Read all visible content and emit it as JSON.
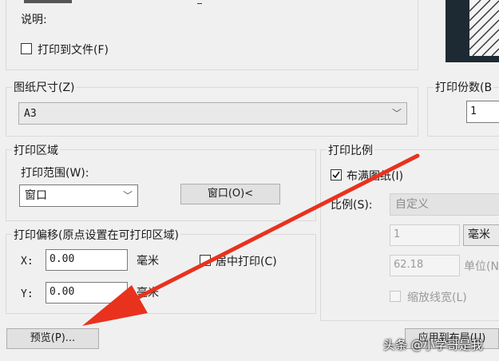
{
  "printer": {
    "description_label": "说明:",
    "print_to_file_label": "打印到文件(F)"
  },
  "paper_size": {
    "group_label": "图纸尺寸(Z)",
    "selected": "A3"
  },
  "copies": {
    "group_label": "打印份数(B",
    "value": "1"
  },
  "plot_area": {
    "group_label": "打印区域",
    "range_label": "打印范围(W):",
    "range_selected": "窗口",
    "window_button": "窗口(O)<"
  },
  "plot_offset": {
    "group_label": "打印偏移(原点设置在可打印区域)",
    "x_label": "X:",
    "x_value": "0.00",
    "x_unit": "毫米",
    "y_label": "Y:",
    "y_value": "0.00",
    "y_unit": "毫米",
    "center_label": "居中打印(C)"
  },
  "plot_scale": {
    "group_label": "打印比例",
    "fit_paper_label": "布满图纸(I)",
    "fit_paper_checked": true,
    "scale_label": "比例(S):",
    "scale_selected": "自定义",
    "value1": "1",
    "unit1": "毫米",
    "value2": "62.18",
    "unit2": "单位(N",
    "lineweights_label": "缩放线宽(L)"
  },
  "buttons": {
    "preview": "预览(P)...",
    "apply_layout": "应用到布局(U)"
  },
  "watermark": "头条 @小学哥是我",
  "colors": {
    "arrow": "#e8321e",
    "background": "#f0f0f0"
  }
}
